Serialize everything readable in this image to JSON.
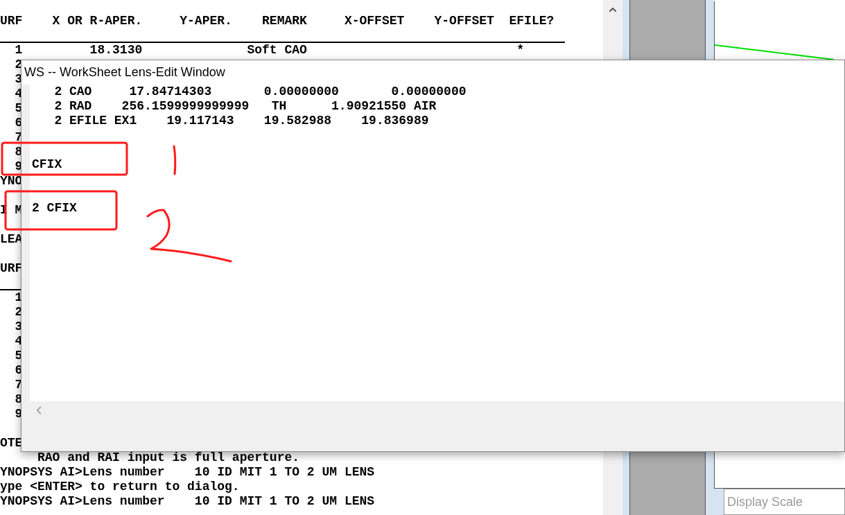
{
  "console": {
    "lines": [
      {
        "kind": "text",
        "text": "URF    X OR R-APER.     Y-APER.    REMARK     X-OFFSET    Y-OFFSET  EFILE?"
      },
      {
        "kind": "rule"
      },
      {
        "kind": "text",
        "text": "  1         18.3130              Soft CAO                            *"
      },
      {
        "kind": "text",
        "text": "  2"
      },
      {
        "kind": "text",
        "text": "  3"
      },
      {
        "kind": "text",
        "text": "  4"
      },
      {
        "kind": "text",
        "text": "  5"
      },
      {
        "kind": "text",
        "text": "  6"
      },
      {
        "kind": "text",
        "text": "  7"
      },
      {
        "kind": "text",
        "text": "  8"
      },
      {
        "kind": "text",
        "text": "  9"
      },
      {
        "kind": "text",
        "text": "YNO"
      },
      {
        "kind": "blank"
      },
      {
        "kind": "text",
        "text": "I M"
      },
      {
        "kind": "blank"
      },
      {
        "kind": "text",
        "text": "LEA"
      },
      {
        "kind": "blank"
      },
      {
        "kind": "text",
        "text": "URF"
      },
      {
        "kind": "rule"
      },
      {
        "kind": "text",
        "text": "  1"
      },
      {
        "kind": "text",
        "text": "  2"
      },
      {
        "kind": "text",
        "text": "  3"
      },
      {
        "kind": "text",
        "text": "  4"
      },
      {
        "kind": "text",
        "text": "  5"
      },
      {
        "kind": "text",
        "text": "  6"
      },
      {
        "kind": "text",
        "text": "  7"
      },
      {
        "kind": "text",
        "text": "  8"
      },
      {
        "kind": "text",
        "text": "  9"
      },
      {
        "kind": "blank"
      },
      {
        "kind": "text",
        "text": "OTE"
      },
      {
        "kind": "text",
        "text": "     RAO and RAI input is full aperture."
      },
      {
        "kind": "text",
        "text": "YNOPSYS AI>Lens number    10 ID MIT 1 TO 2 UM LENS"
      },
      {
        "kind": "text",
        "text": "ype <ENTER> to return to dialog."
      },
      {
        "kind": "text",
        "text": "YNOPSYS AI>Lens number    10 ID MIT 1 TO 2 UM LENS"
      }
    ]
  },
  "window": {
    "title": "WS -- WorkSheet Lens-Edit Window",
    "lines": [
      {
        "kind": "text",
        "text": "   2 CAO     17.84714303       0.00000000       0.00000000"
      },
      {
        "kind": "text",
        "text": "   2 RAD    256.1599999999999   TH      1.90921550 AIR"
      },
      {
        "kind": "text",
        "text": "   2 EFILE EX1    19.117143    19.582988    19.836989"
      },
      {
        "kind": "blank"
      },
      {
        "kind": "blank"
      },
      {
        "kind": "text",
        "text": "CFIX"
      },
      {
        "kind": "blank"
      },
      {
        "kind": "blank"
      },
      {
        "kind": "text",
        "text": "2 CFIX"
      }
    ]
  },
  "side_panel": {
    "label": "Display Scale"
  }
}
